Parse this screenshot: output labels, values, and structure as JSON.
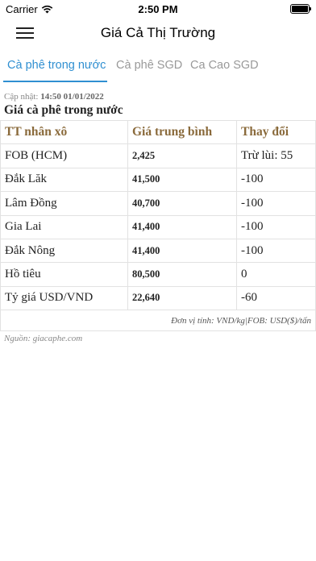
{
  "status_bar": {
    "carrier": "Carrier",
    "time": "2:50 PM",
    "battery_level": 1.0
  },
  "nav": {
    "title": "Giá Cả Thị Trường",
    "menu_icon": "hamburger-menu-icon"
  },
  "tabs": [
    {
      "label": "Cà phê trong nước",
      "active": true
    },
    {
      "label": "Cà phê SGD",
      "active": false
    },
    {
      "label": "Ca Cao SGD",
      "active": false
    }
  ],
  "colors": {
    "accent": "#2f8fd1",
    "header_text": "#8a6a3b",
    "inactive_tab": "#999999"
  },
  "content": {
    "updated_label": "Cập nhật:",
    "updated_value": "14:50 01/01/2022",
    "section_title": "Giá cà phê trong nước",
    "table": {
      "headers": [
        "TT nhân xô",
        "Giá trung bình",
        "Thay đổi"
      ],
      "rows": [
        {
          "market": "FOB (HCM)",
          "price": "2,425",
          "change": "Trừ lùi: 55"
        },
        {
          "market": "Đắk Lăk",
          "price": "41,500",
          "change": "-100"
        },
        {
          "market": "Lâm Đồng",
          "price": "40,700",
          "change": "-100"
        },
        {
          "market": "Gia Lai",
          "price": "41,400",
          "change": "-100"
        },
        {
          "market": "Đắk Nông",
          "price": "41,400",
          "change": "-100"
        },
        {
          "market": "Hồ tiêu",
          "price": "80,500",
          "change": "0"
        },
        {
          "market": "Tỷ giá USD/VND",
          "price": "22,640",
          "change": "-60"
        }
      ],
      "unit_note": "Đơn vị tính: VND/kg|FOB: USD($)/tấn"
    },
    "source": "Nguồn: giacaphe.com"
  }
}
